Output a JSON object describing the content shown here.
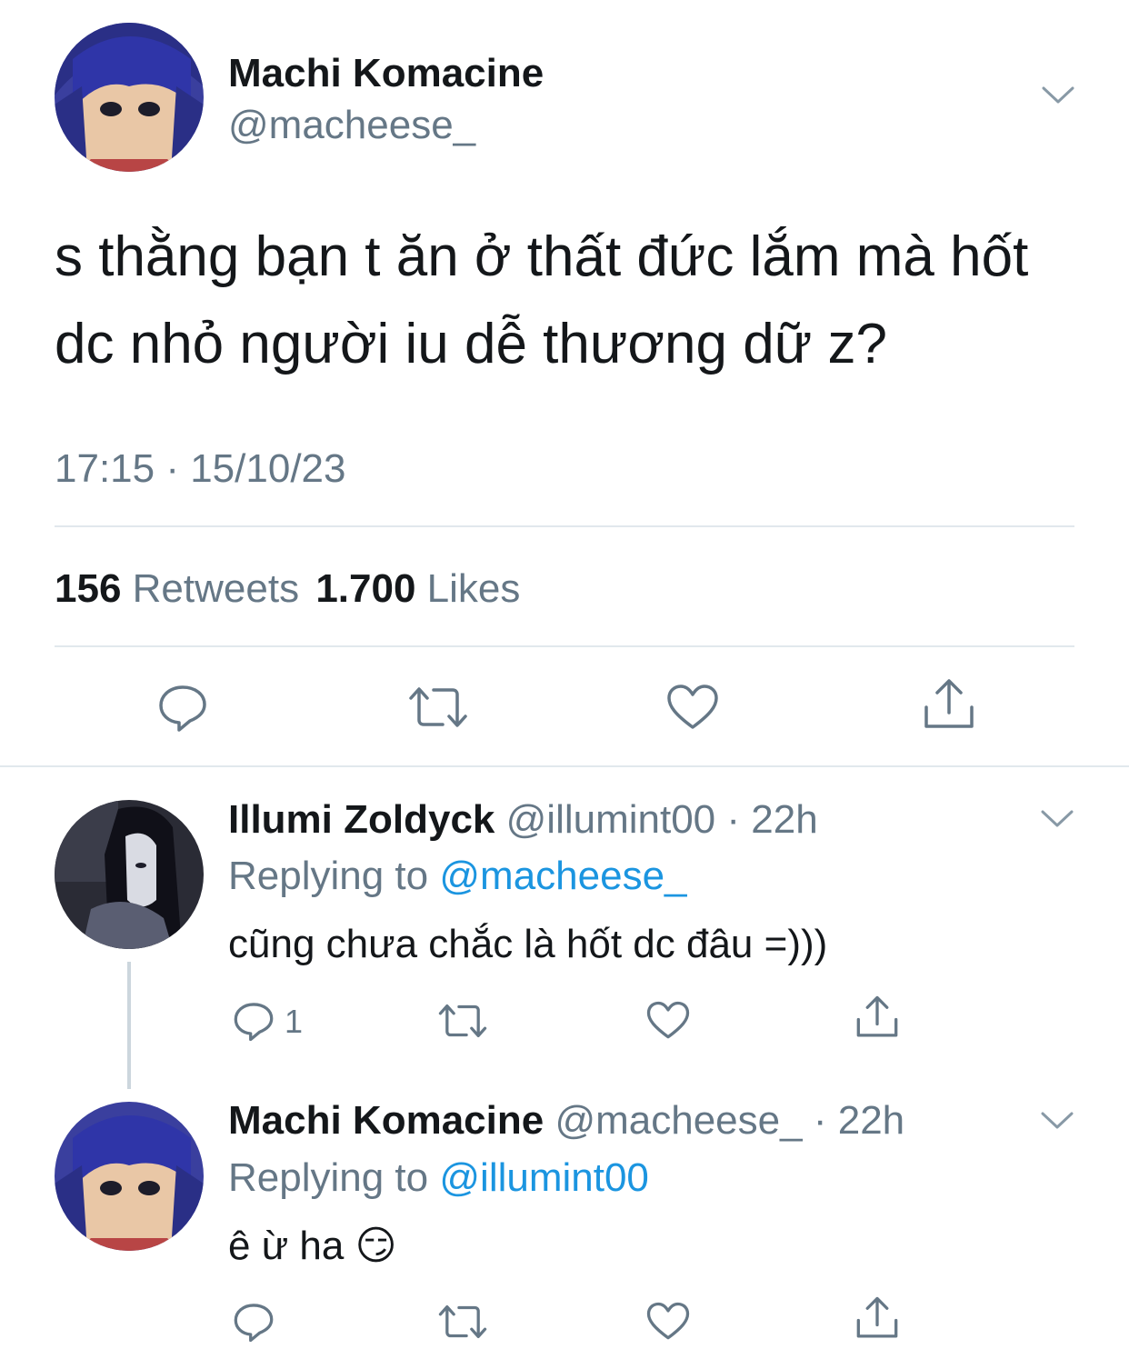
{
  "main_tweet": {
    "author_name": "Machi Komacine",
    "author_handle": "@macheese_",
    "text_line1": "s thằng bạn t ăn ở thất đức lắm mà hốt",
    "text_line2": "dc nhỏ người iu dễ thương dữ z?",
    "timestamp": "17:15 · 15/10/23",
    "retweet_count": "156",
    "retweet_label": "Retweets",
    "like_count": "1.700",
    "like_label": "Likes"
  },
  "replies": [
    {
      "author_name": "Illumi Zoldyck",
      "author_handle": "@illumint00",
      "time": "22h",
      "replying_label": "Replying to",
      "replying_to": "@macheese_",
      "text": "cũng chưa chắc là hốt dc đâu =)))",
      "reply_count": "1"
    },
    {
      "author_name": "Machi Komacine",
      "author_handle": "@macheese_",
      "time": "22h",
      "replying_label": "Replying to",
      "replying_to": "@illumint00",
      "text": "ê ừ ha",
      "emoji": "😏"
    }
  ],
  "icons": [
    "chevron-down-icon",
    "reply-icon",
    "retweet-icon",
    "like-icon",
    "share-icon"
  ],
  "colors": {
    "text": "#14171a",
    "secondary": "#657786",
    "link": "#1b95e0",
    "divider": "#e1e8ed"
  }
}
